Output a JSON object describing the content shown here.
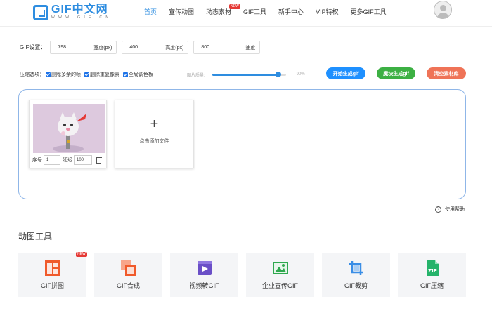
{
  "header": {
    "logo_title": "GIF中文网",
    "logo_sub": "W W W . G I F . C N",
    "nav": [
      {
        "label": "首页",
        "active": true
      },
      {
        "label": "宣传动图"
      },
      {
        "label": "动态素材",
        "badge": "NEW"
      },
      {
        "label": "GIF工具"
      },
      {
        "label": "新手中心"
      },
      {
        "label": "VIP特权"
      },
      {
        "label": "更多GIF工具"
      }
    ]
  },
  "settings": {
    "label": "GIF设置：",
    "width": {
      "value": "798",
      "unit": "宽度(px)"
    },
    "height": {
      "value": "400",
      "unit": "高度(px)"
    },
    "speed": {
      "value": "800",
      "unit": "速度"
    }
  },
  "options": {
    "label": "压缩选项：",
    "items": [
      "删除多余的帧",
      "删除重复像素",
      "全局调色板"
    ],
    "quality_label": "图片质量:",
    "quality_value": "90%",
    "quality_fraction": 0.9
  },
  "buttons": {
    "start": "开始生成gif",
    "magic": "魔块生成gif",
    "clear": "清空素材库"
  },
  "frame": {
    "seq_label": "序号",
    "seq_value": "1",
    "delay_label": "延迟",
    "delay_value": "100"
  },
  "add_file_label": "点击添加文件",
  "help_label": "使用帮助",
  "tools_title": "动图工具",
  "tools": [
    {
      "name": "GIF拼图",
      "badge": "NEW"
    },
    {
      "name": "GIF合成"
    },
    {
      "name": "视频转GIF"
    },
    {
      "name": "企业宣传GIF"
    },
    {
      "name": "GIF裁剪"
    },
    {
      "name": "GIF压缩"
    }
  ],
  "colors": {
    "accent": "#2e8de0",
    "start": "#1e90ff",
    "magic": "#3cb043",
    "clear": "#ef7357",
    "badge": "#e53935"
  }
}
